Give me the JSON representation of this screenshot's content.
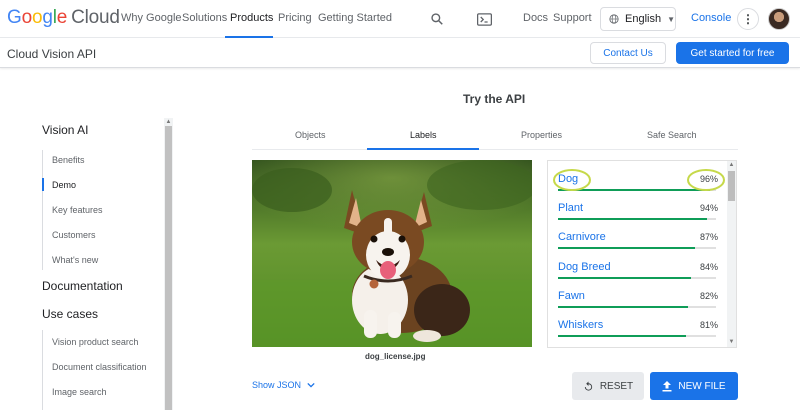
{
  "topnav": {
    "logo": {
      "g": "G",
      "o1": "o",
      "o2": "o",
      "g2": "g",
      "l": "l",
      "e": "e",
      "cloud": "Cloud"
    },
    "items": [
      {
        "label": "Why Google"
      },
      {
        "label": "Solutions"
      },
      {
        "label": "Products"
      },
      {
        "label": "Pricing"
      },
      {
        "label": "Getting Started"
      }
    ],
    "search_icon": "search-icon",
    "terminal_icon": "terminal-icon",
    "docs": "Docs",
    "support": "Support",
    "language": "English",
    "console": "Console",
    "more": "⋮"
  },
  "subbar": {
    "product_name": "Cloud Vision API",
    "contact": "Contact Us",
    "get_started": "Get started for free"
  },
  "sidebar": {
    "section1": "Vision AI",
    "items": [
      {
        "label": "Benefits"
      },
      {
        "label": "Demo"
      },
      {
        "label": "Key features"
      },
      {
        "label": "Customers"
      },
      {
        "label": "What's new"
      }
    ],
    "section2": "Documentation",
    "section3": "Use cases",
    "use_cases": [
      {
        "label": "Vision product search"
      },
      {
        "label": "Document classification"
      },
      {
        "label": "Image search"
      }
    ]
  },
  "main": {
    "title": "Try the API",
    "tabs": [
      {
        "label": "Objects"
      },
      {
        "label": "Labels"
      },
      {
        "label": "Properties"
      },
      {
        "label": "Safe Search"
      }
    ],
    "image_caption": "dog_license.jpg",
    "labels": [
      {
        "label": "Dog",
        "pct": "96%",
        "value": 0.96
      },
      {
        "label": "Plant",
        "pct": "94%",
        "value": 0.94
      },
      {
        "label": "Carnivore",
        "pct": "87%",
        "value": 0.87
      },
      {
        "label": "Dog Breed",
        "pct": "84%",
        "value": 0.84
      },
      {
        "label": "Fawn",
        "pct": "82%",
        "value": 0.82
      },
      {
        "label": "Whiskers",
        "pct": "81%",
        "value": 0.81
      }
    ],
    "show_json": "Show JSON",
    "reset": "RESET",
    "new_file": "NEW FILE"
  },
  "colors": {
    "accent": "#1a73e8",
    "bar_fill": "#0f9d58",
    "highlight": "#c6d94a"
  }
}
